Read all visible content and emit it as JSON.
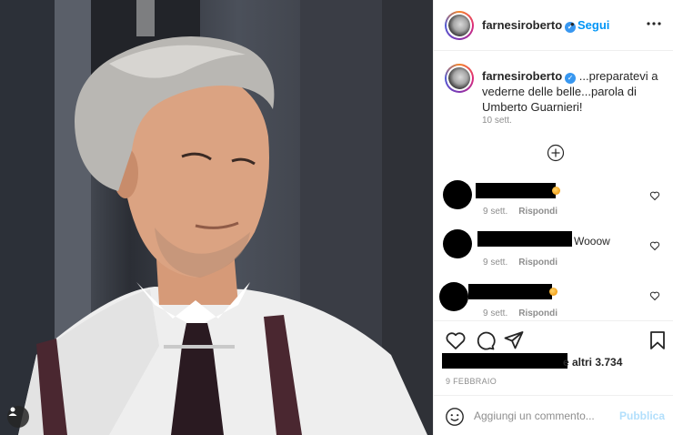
{
  "post": {
    "username": "farnesiroberto",
    "verified_icon": "verified-badge-icon",
    "separator": "•",
    "follow_label": "Segui",
    "more_icon": "more-horizontal-icon"
  },
  "caption": {
    "username": "farnesiroberto",
    "text": " ...preparatevi a vederne delle belle...parola di Umberto Guarnieri!",
    "time": "10 sett."
  },
  "load_more_icon": "plus-circle-icon",
  "comments": [
    {
      "text": "",
      "time": "9 sett.",
      "reply_label": "Rispondi"
    },
    {
      "text": "Wooow",
      "time": "9 sett.",
      "reply_label": "Rispondi"
    },
    {
      "text": "",
      "time": "9 sett.",
      "reply_label": "Rispondi"
    }
  ],
  "actions": {
    "like_icon": "heart-icon",
    "comment_icon": "comment-icon",
    "share_icon": "paper-plane-icon",
    "save_icon": "bookmark-icon"
  },
  "likes_text": "e altri 3.734",
  "post_date": "9 FEBBRAIO",
  "comment_box": {
    "placeholder": "Aggiungi un commento...",
    "publish_label": "Pubblica",
    "emoji_icon": "smiley-icon"
  },
  "photo": {
    "user_tag_icon": "user-tag-icon"
  },
  "colors": {
    "accent": "#0095f6",
    "publish_disabled": "#b2dffc",
    "muted": "#8e8e8e",
    "text": "#262626"
  }
}
